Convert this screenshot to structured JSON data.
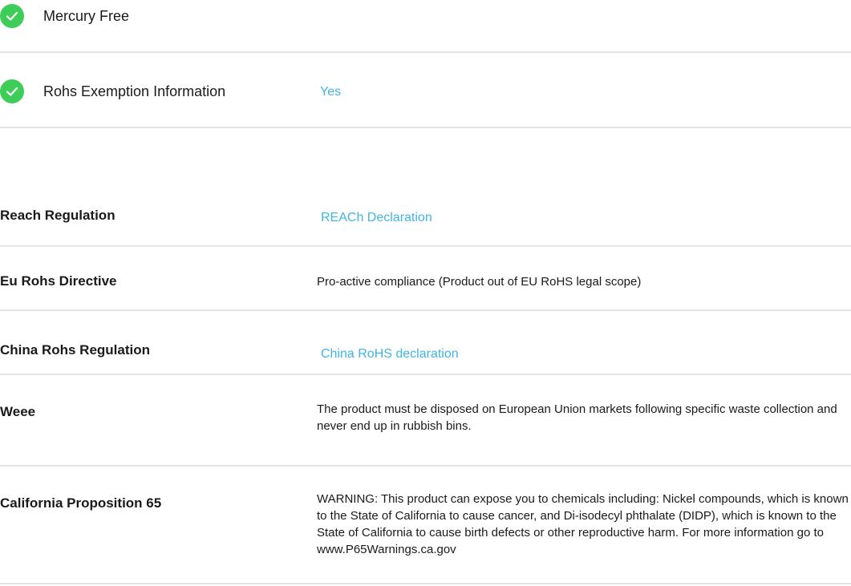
{
  "checks": [
    {
      "icon": "checkmark-icon",
      "label": "Mercury Free",
      "value": ""
    },
    {
      "icon": "checkmark-icon",
      "label": "Rohs Exemption Information",
      "value": "Yes"
    }
  ],
  "regulations": [
    {
      "label": "Reach Regulation",
      "link": "REACh Declaration"
    },
    {
      "label": "Eu Rohs Directive",
      "text": "Pro-active compliance (Product out of EU RoHS legal scope)"
    },
    {
      "label": "China Rohs Regulation",
      "link": "China RoHS declaration"
    },
    {
      "label": "Weee",
      "text": "The product must be disposed on European Union markets following specific waste collection and never end up in rubbish bins."
    },
    {
      "label": "California Proposition 65",
      "text": "WARNING: This product can expose you to chemicals including: Nickel compounds, which is known to the State of California to cause cancer, and Di-isodecyl phthalate (DIDP), which is known to the State of California to cause birth defects or other reproductive harm. For more information go to www.P65Warnings.ca.gov"
    }
  ],
  "colors": {
    "check_green": "#3dcd58",
    "link_blue": "#42b4e6",
    "divider": "#e4e4e4"
  }
}
